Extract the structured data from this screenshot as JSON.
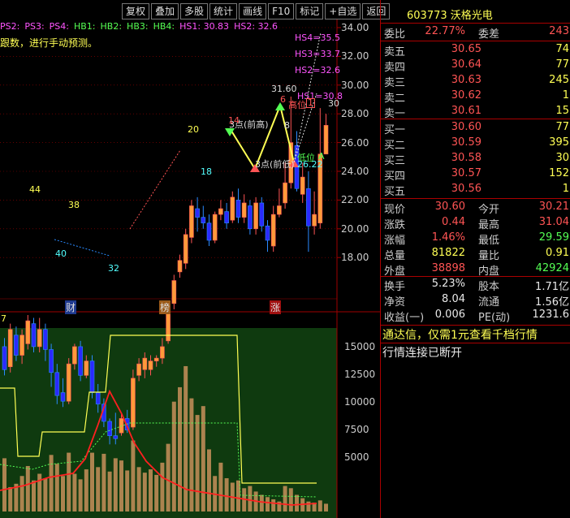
{
  "toolbar": [
    "复权",
    "叠加",
    "多股",
    "统计",
    "画线",
    "F10",
    "标记",
    "+自选",
    "返回"
  ],
  "legend": [
    {
      "text": "PS2:",
      "color": "#ff55ff"
    },
    {
      "text": "PS3:",
      "color": "#ff55ff"
    },
    {
      "text": "PS4:",
      "color": "#ff55ff"
    },
    {
      "text": "HB1:",
      "color": "#54ff54"
    },
    {
      "text": "HB2:",
      "color": "#54ff54"
    },
    {
      "text": "HB3:",
      "color": "#54ff54"
    },
    {
      "text": "HB4:",
      "color": "#54ff54"
    },
    {
      "text": "HS1: 30.83",
      "color": "#ff55ff"
    },
    {
      "text": "HS2: 32.6",
      "color": "#ff55ff"
    }
  ],
  "hint": "跟数，进行手动预测。",
  "price_axis": [
    "34.00",
    "32.00",
    "30.00",
    "28.00",
    "26.00",
    "24.00",
    "22.00",
    "20.00",
    "18.00"
  ],
  "vol_axis": [
    "15000",
    "12500",
    "10000",
    "7500",
    "5000"
  ],
  "annotations": {
    "hs4": "HS4=35.5",
    "hs3": "HS3=33.7",
    "hs2": "HS2=32.6",
    "hs1": "HS1=30.8",
    "high_price": "31.60",
    "gaowei": "高位",
    "l1": "1",
    "l2": "30",
    "di_wei": "低位",
    "di_wei_A": "A",
    "low_price": "26.22",
    "peak_num": "6",
    "b_mark": "B",
    "n44": "44",
    "n38": "38",
    "n40": "40",
    "n32": "32",
    "n20": "20",
    "n18": "18",
    "n14": "14",
    "n8": "8",
    "pt_high": "3点(前高)",
    "pt_low": "3点(前低)",
    "cai": "财",
    "bang": "榜",
    "zhang": "涨",
    "sub_label": "7"
  },
  "stock": {
    "code": "603773",
    "name": "沃格光电"
  },
  "weibi": {
    "label": "委比",
    "value": "22.77%",
    "label2": "委差",
    "value2": "243"
  },
  "asks": [
    {
      "label": "卖五",
      "price": "30.65",
      "vol": "74"
    },
    {
      "label": "卖四",
      "price": "30.64",
      "vol": "77"
    },
    {
      "label": "卖三",
      "price": "30.63",
      "vol": "245"
    },
    {
      "label": "卖二",
      "price": "30.62",
      "vol": "1"
    },
    {
      "label": "卖一",
      "price": "30.61",
      "vol": "15"
    }
  ],
  "bids": [
    {
      "label": "买一",
      "price": "30.60",
      "vol": "77"
    },
    {
      "label": "买二",
      "price": "30.59",
      "vol": "395"
    },
    {
      "label": "买三",
      "price": "30.58",
      "vol": "30"
    },
    {
      "label": "买四",
      "price": "30.57",
      "vol": "152"
    },
    {
      "label": "买五",
      "price": "30.56",
      "vol": "1"
    }
  ],
  "quote": [
    {
      "l1": "现价",
      "v1": "30.60",
      "c1": "red",
      "l2": "今开",
      "v2": "30.21",
      "c2": "red"
    },
    {
      "l1": "涨跌",
      "v1": "0.44",
      "c1": "red",
      "l2": "最高",
      "v2": "31.04",
      "c2": "red"
    },
    {
      "l1": "涨幅",
      "v1": "1.46%",
      "c1": "red",
      "l2": "最低",
      "v2": "29.59",
      "c2": "green"
    },
    {
      "l1": "总量",
      "v1": "81822",
      "c1": "yellow",
      "l2": "量比",
      "v2": "0.91",
      "c2": "yellow"
    },
    {
      "l1": "外盘",
      "v1": "38898",
      "c1": "red",
      "l2": "内盘",
      "v2": "42924",
      "c2": "green"
    }
  ],
  "fund": [
    {
      "l1": "换手",
      "v1": "5.23%",
      "l2": "股本",
      "v2": "1.71亿"
    },
    {
      "l1": "净资",
      "v1": "8.04",
      "l2": "流通",
      "v2": "1.56亿"
    },
    {
      "l1": "收益(一)",
      "v1": "0.006",
      "l2": "PE(动)",
      "v2": "1231.6"
    }
  ],
  "notice": "通达信，仅需1元查看千档行情",
  "status": "行情连接已断开",
  "colors": {
    "up": "#ff9a3a",
    "down": "#2a2aff",
    "bg_sub": "#0f3a0f",
    "grid": "#a00000"
  }
}
